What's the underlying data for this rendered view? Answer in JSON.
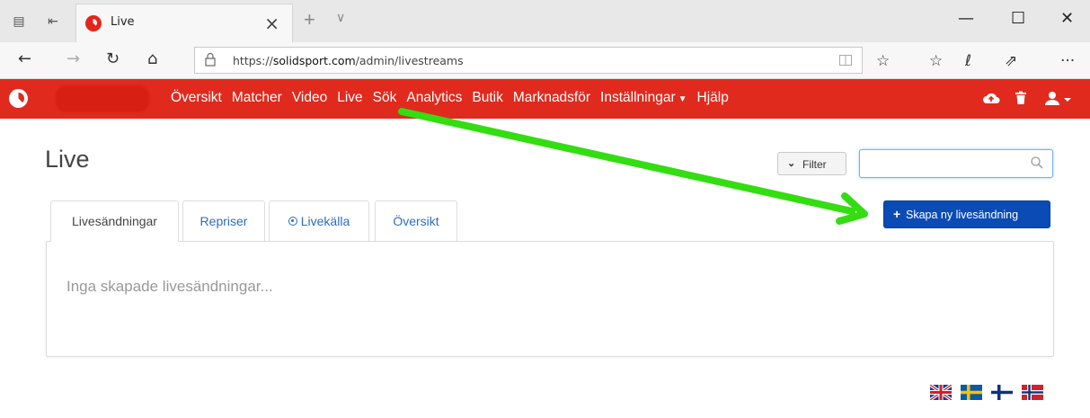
{
  "browser": {
    "tab_title": "Live",
    "tab_close": "×",
    "new_tab": "+",
    "tab_menu": "∨",
    "window_buttons": {
      "minimize": "—",
      "maximize": "☐",
      "close": "✕"
    },
    "nav": {
      "back": "←",
      "forward": "→",
      "refresh": "↻",
      "home": "⌂"
    },
    "url_prefix": "https://",
    "url_domain": "solidsport.com",
    "url_path": "/admin/livestreams",
    "icons": [
      "reading-view-icon",
      "favorite-star-icon",
      "favorites-list-icon",
      "pen-icon",
      "share-icon",
      "more-icon"
    ],
    "more": "···"
  },
  "navbar": {
    "items": [
      "Översikt",
      "Matcher",
      "Video",
      "Live",
      "Sök",
      "Analytics",
      "Butik",
      "Marknadsför",
      "Inställningar",
      "Hjälp"
    ],
    "accent": "#e02a1d"
  },
  "page": {
    "title": "Live",
    "filter_label": "Filter",
    "search_placeholder": "",
    "create_button": "Skapa ny livesändning",
    "tabs": [
      "Livesändningar",
      "Repriser",
      "Livekälla",
      "Översikt"
    ],
    "active_tab": "Livesändningar",
    "empty_message": "Inga skapade livesändningar...",
    "languages": [
      "uk-flag-icon",
      "sweden-flag-icon",
      "finland-flag-icon",
      "norway-flag-icon"
    ]
  },
  "colors": {
    "link": "#2a6dbf",
    "primary_button": "#0a4bb5",
    "annotation_arrow": "#33dd11"
  }
}
